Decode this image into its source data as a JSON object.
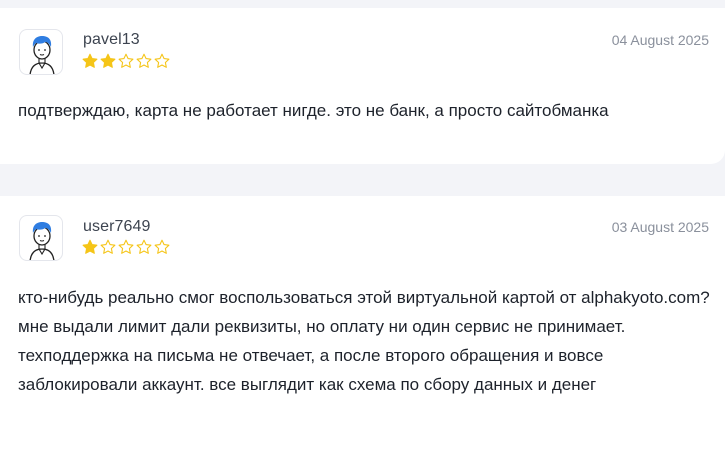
{
  "reviews": [
    {
      "username": "pavel13",
      "date": "04 August 2025",
      "rating": 2,
      "max_rating": 5,
      "text": "подтверждаю, карта не работает нигде. это не банк, а просто сайтобманка"
    },
    {
      "username": "user7649",
      "date": "03 August 2025",
      "rating": 1,
      "max_rating": 5,
      "text": "кто-нибудь реально смог воспользоваться этой виртуальной картой от alphakyoto.com? мне выдали лимит дали реквизиты, но оплату ни один сервис не принимает. техподдержка на письма не отвечает, а после второго обращения и вовсе заблокировали аккаунт. все выглядит как схема по сбору данных и денег"
    }
  ],
  "icons": {
    "avatar": "user-avatar-icon",
    "star_filled": "star-filled-icon",
    "star_empty": "star-outline-icon"
  },
  "colors": {
    "star": "#f5c518",
    "avatar_hair": "#2f7de1"
  }
}
